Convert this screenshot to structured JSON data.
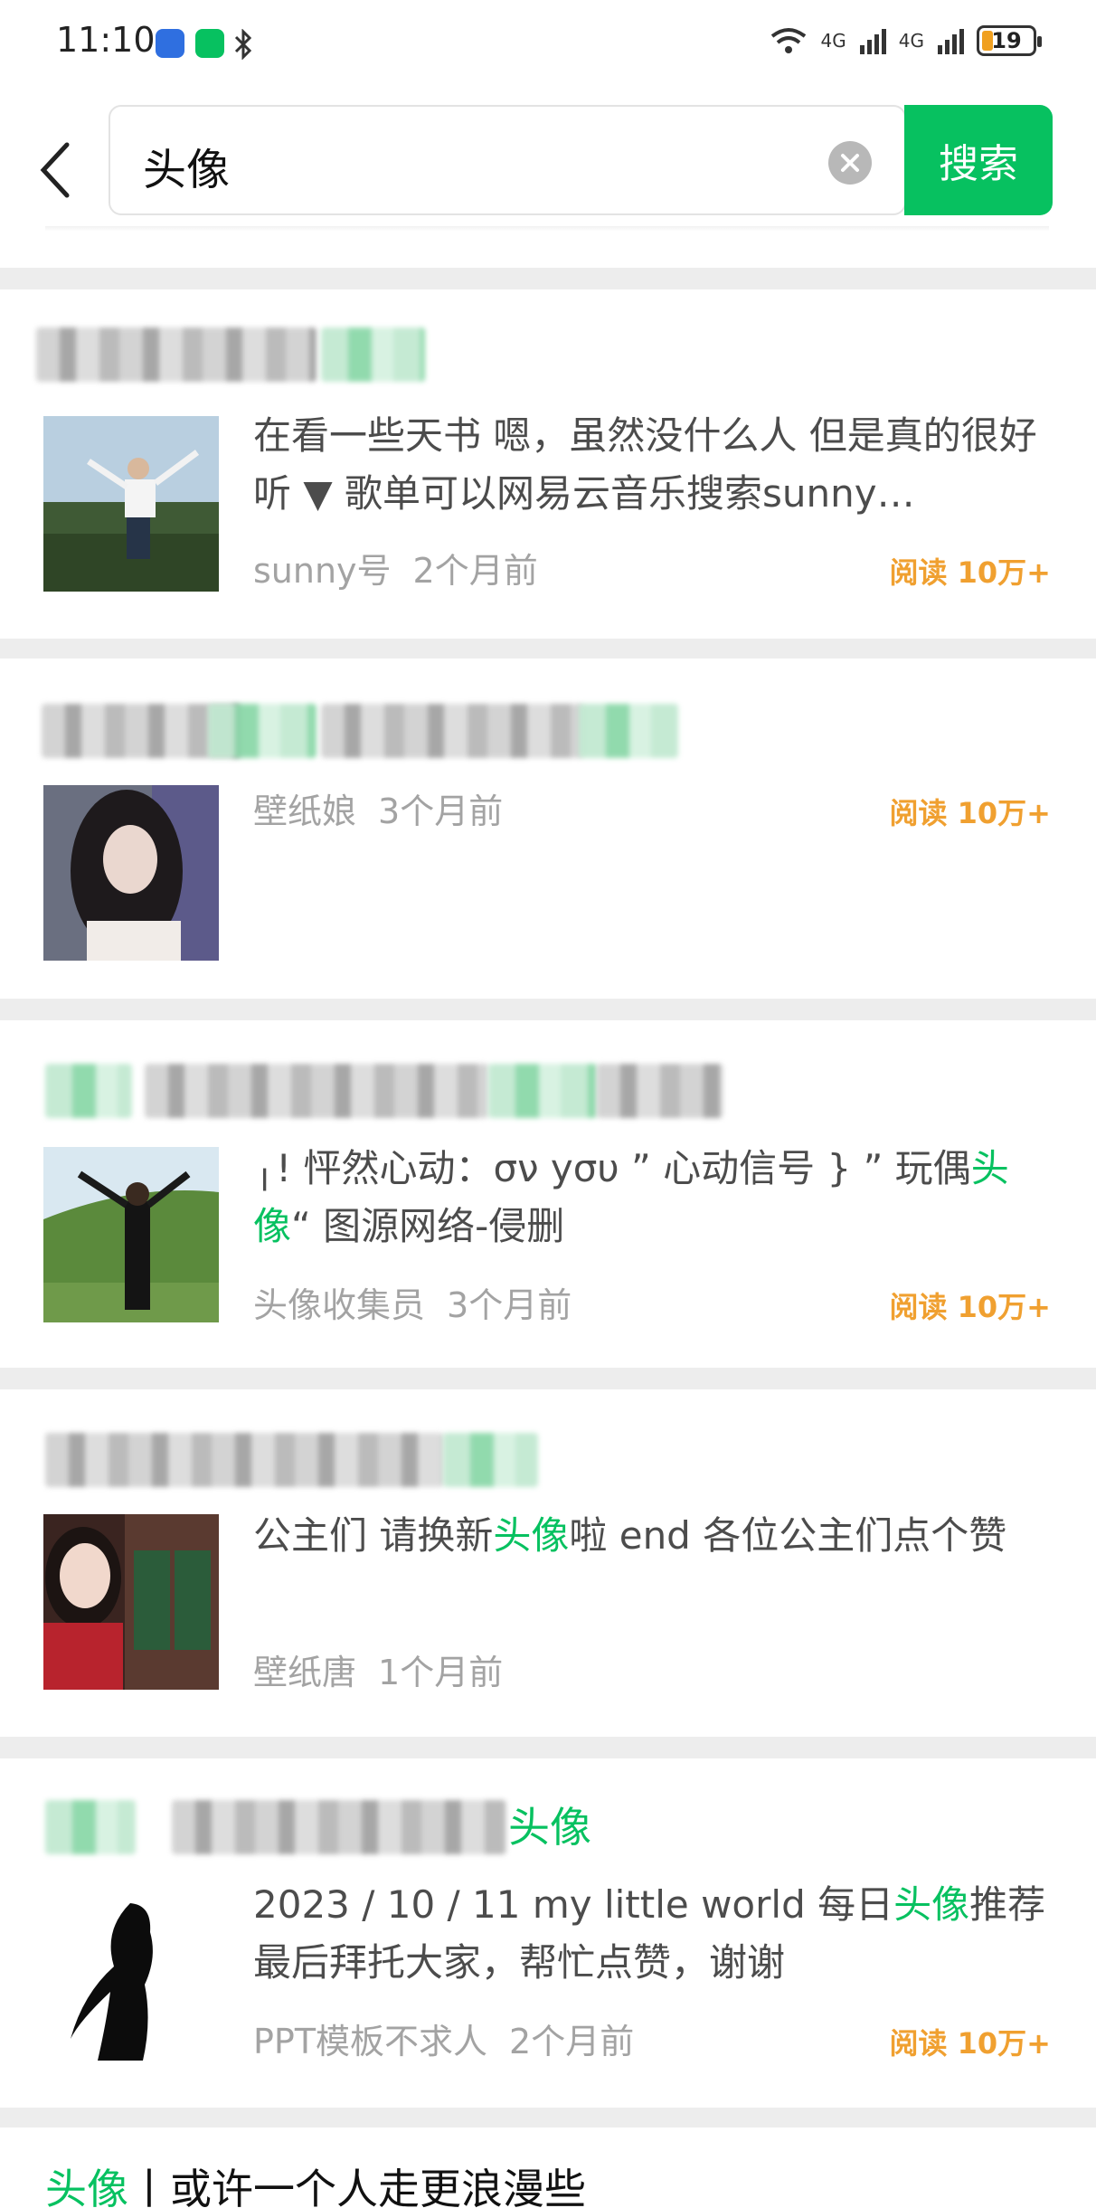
{
  "status_bar": {
    "time": "11:10",
    "signal_1": "4G",
    "signal_2": "4G",
    "battery": "19"
  },
  "search": {
    "back_icon": "chevron-left-icon",
    "query": "头像",
    "clear_icon": "clear-icon",
    "button_label": "搜索"
  },
  "results": [
    {
      "title_visible": "",
      "description": "在看一些天书 嗯，虽然没什么人 但是真的很好听 ▼ 歌单可以网易云音乐搜索sunny…",
      "source": "sunny号",
      "time": "2个月前",
      "reads": "阅读 10万+"
    },
    {
      "title_visible": "",
      "description": "",
      "source": "壁纸娘",
      "time": "3个月前",
      "reads": "阅读 10万+"
    },
    {
      "title_visible": "",
      "description_pre": "╷! 怦然心动：σν yσυ ” 心动信号 } ” 玩偶",
      "description_hl": "头像",
      "description_post": "“ 图源网络-侵删",
      "source": "头像收集员",
      "time": "3个月前",
      "reads": "阅读 10万+"
    },
    {
      "title_visible": "",
      "description_pre": "公主们 请换新",
      "description_hl": "头像",
      "description_post": "啦 end 各位公主们点个赞",
      "source": "壁纸唐",
      "time": "1个月前",
      "reads": ""
    },
    {
      "title_visible_hl": "头像",
      "description_pre": "2023 / 10 / 11 my little world 每日",
      "description_hl": "头像",
      "description_post": "推荐 最后拜托大家，帮忙点赞，谢谢",
      "source": "PPT模板不求人",
      "time": "2个月前",
      "reads": "阅读 10万+"
    },
    {
      "title_hl": "头像",
      "title_rest": "丨或许一个人走更浪漫些"
    }
  ],
  "colors": {
    "accent": "#07c160",
    "reads": "#f0a030",
    "meta": "#a3a3a3"
  }
}
